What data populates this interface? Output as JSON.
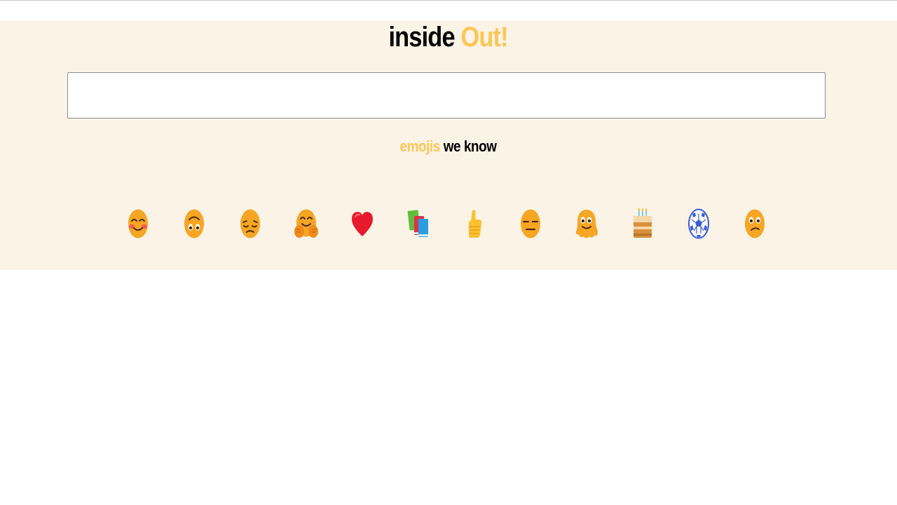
{
  "header": {
    "title_part1": "inside",
    "title_part2": "Out!"
  },
  "search": {
    "value": "",
    "placeholder": ""
  },
  "section": {
    "label_part1": "emojis",
    "label_part2": "we know"
  },
  "emojis": [
    {
      "icon": "smiling-face-with-smiling-eyes-icon"
    },
    {
      "icon": "upside-down-face-icon"
    },
    {
      "icon": "pensive-face-icon"
    },
    {
      "icon": "hugging-face-icon"
    },
    {
      "icon": "red-heart-icon"
    },
    {
      "icon": "books-icon"
    },
    {
      "icon": "thumbs-up-icon"
    },
    {
      "icon": "expressionless-face-icon"
    },
    {
      "icon": "melting-face-icon"
    },
    {
      "icon": "birthday-cake-icon"
    },
    {
      "icon": "soccer-ball-icon"
    },
    {
      "icon": "confused-face-icon"
    }
  ],
  "colors": {
    "accent": "#fbc654",
    "band_background": "#fcf3e7",
    "text": "#000000",
    "emoji_face": "#f6a623"
  }
}
